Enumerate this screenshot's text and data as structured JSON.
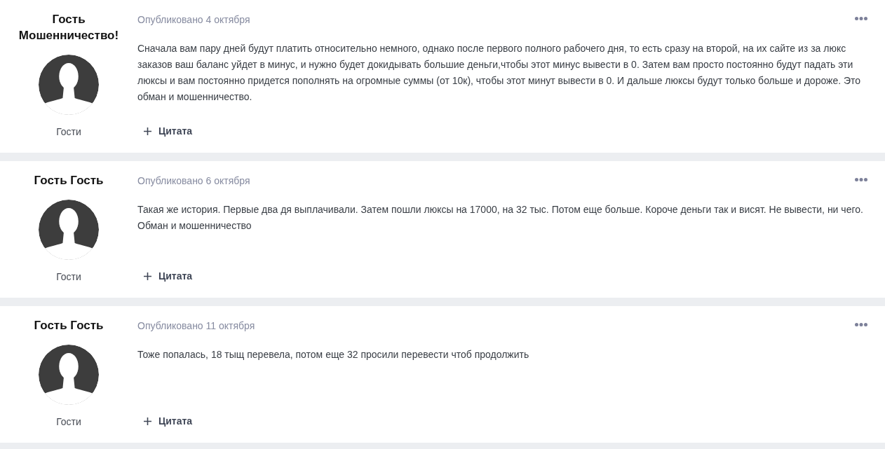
{
  "posts": [
    {
      "author": "Гость Мошенничество!",
      "group": "Гости",
      "date": "Опубликовано 4 октября",
      "body": "Сначала вам пару дней будут платить относительно немного, однако после первого полного рабочего дня, то есть сразу на второй, на их сайте из за люкс заказов ваш баланс уйдет в минус, и нужно будет докидывать большие деньги,чтобы этот минус вывести в 0. Затем вам просто постоянно будут падать эти люксы и вам постоянно придется пополнять на огромные суммы (от 10к), чтобы этот минут вывести в 0. И дальше люксы будут только больше и дороже. Это обман и мошенничество.",
      "quote_label": "Цитата"
    },
    {
      "author": "Гость Гость",
      "group": "Гости",
      "date": "Опубликовано 6 октября",
      "body": "Такая же история. Первые два дя выплачивали. Затем пошли люксы на 17000, на 32 тыс. Потом еще больше. Короче деньги так и висят. Не вывести, ни чего. Обман и мошенничество",
      "quote_label": "Цитата"
    },
    {
      "author": "Гость Гость",
      "group": "Гости",
      "date": "Опубликовано 11 октября",
      "body": "Тоже попалась, 18 тыщ перевела, потом еще 32 просили перевести чтоб продолжить",
      "quote_label": "Цитата"
    }
  ]
}
